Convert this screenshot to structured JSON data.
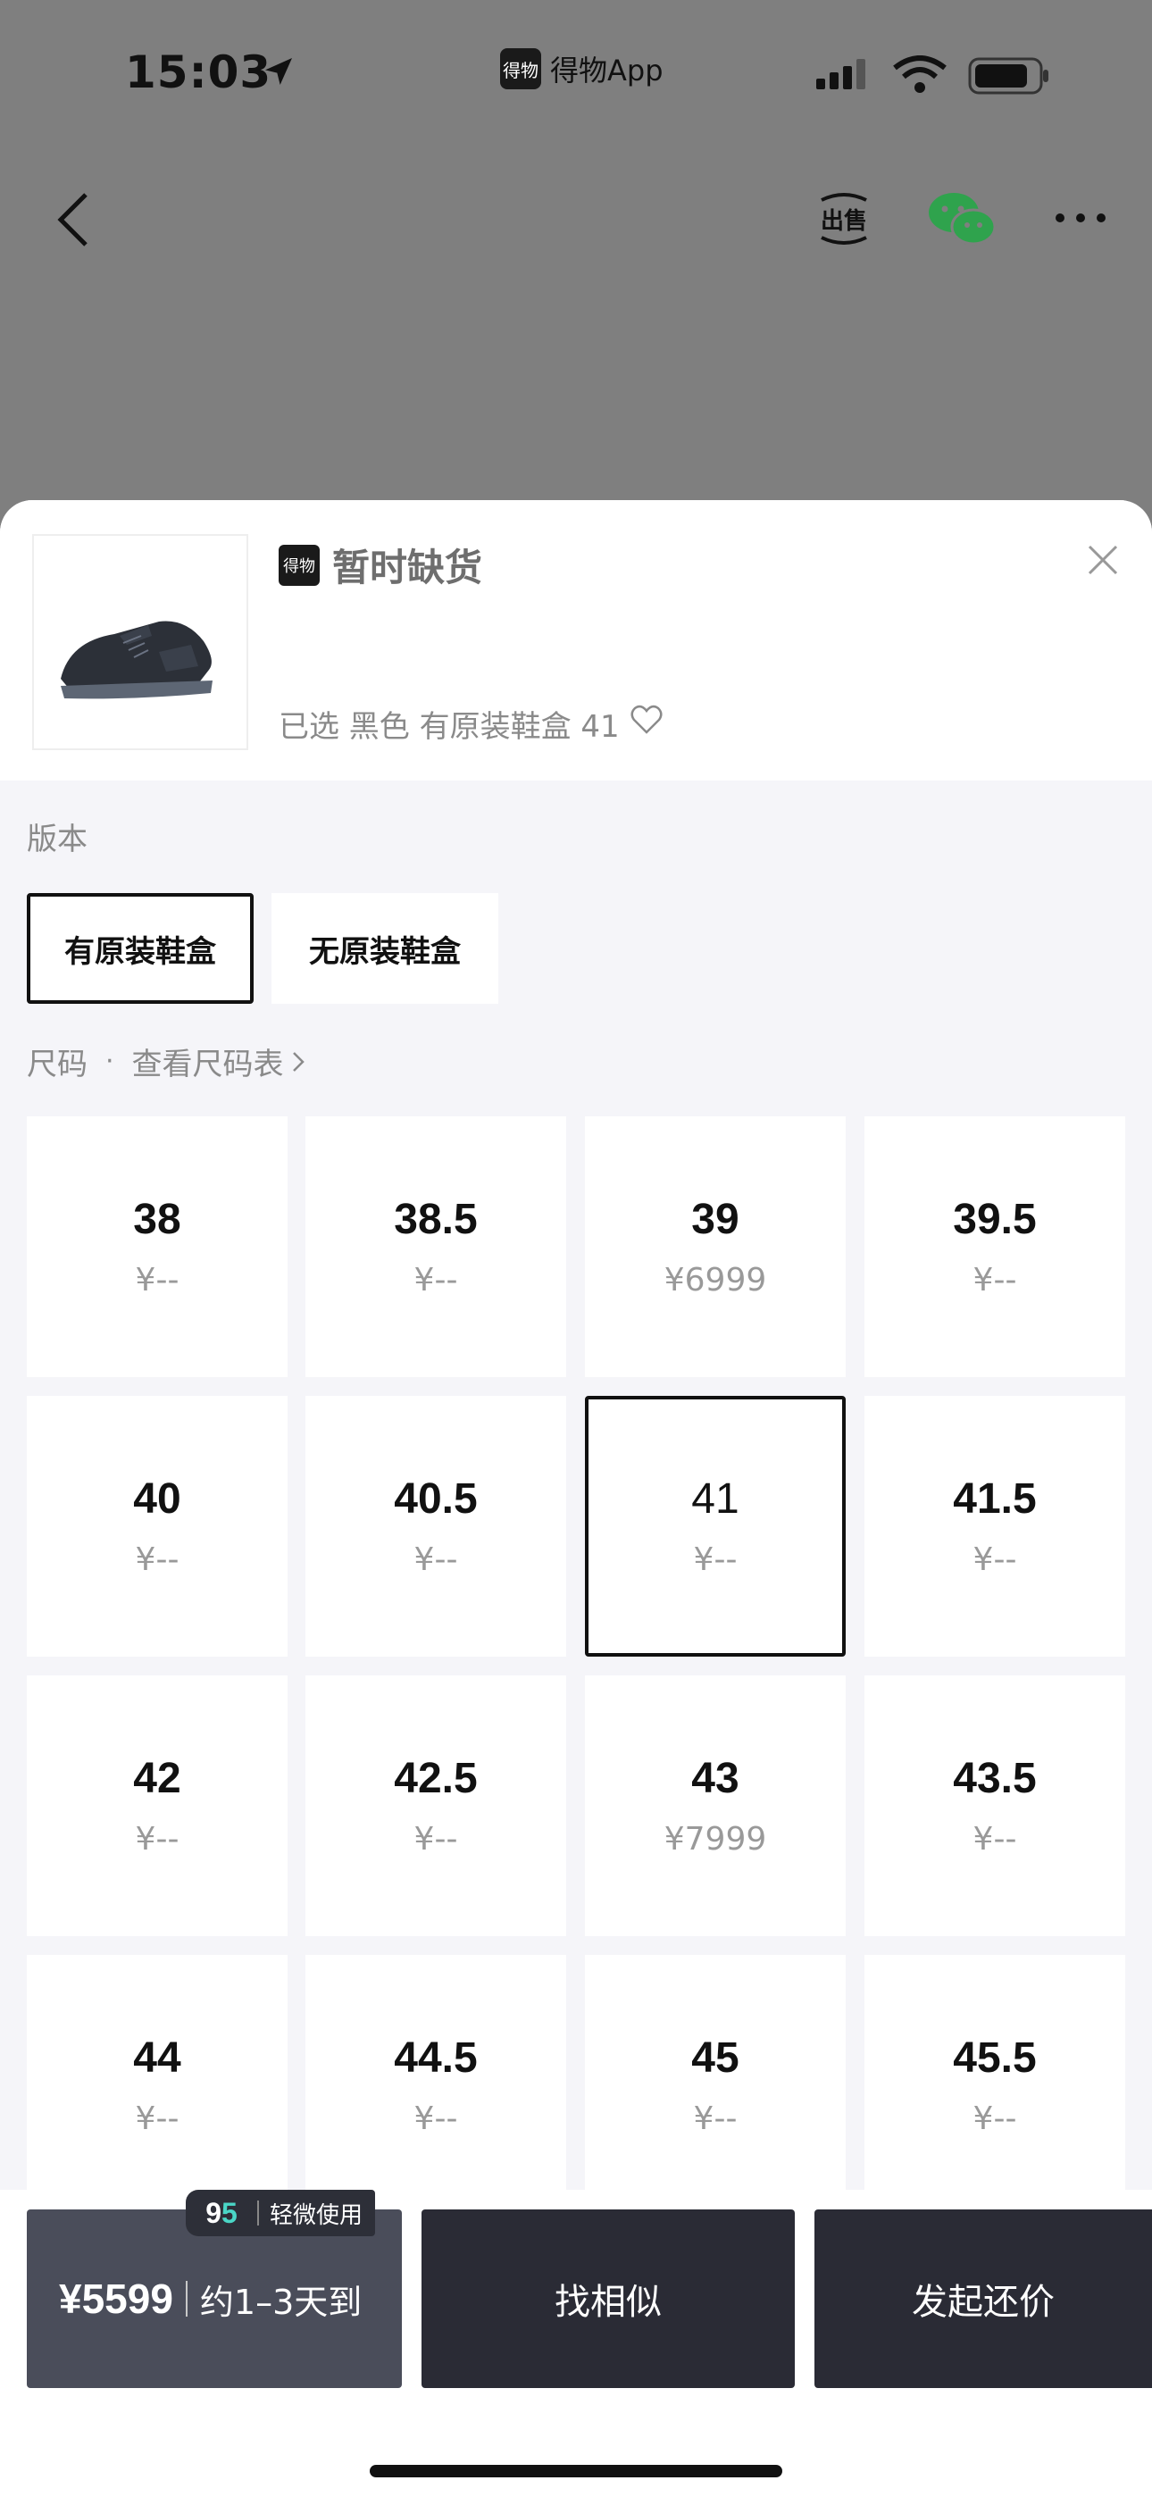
{
  "status": {
    "time": "15:03",
    "app_logo": "得物",
    "app_name": "得物App"
  },
  "nav": {
    "back_icon": "back-chevron-icon",
    "sell_icon": "sell-icon",
    "sell_label": "出售",
    "wechat_icon": "wechat-icon",
    "more_icon": "more-icon"
  },
  "sheet": {
    "stock_logo": "得物",
    "stock_status": "暂时缺货",
    "selected_summary": "已选 黑色 有原装鞋盒 41",
    "version_label": "版本",
    "versions": [
      {
        "label": "有原装鞋盒",
        "selected": true
      },
      {
        "label": "无原装鞋盒",
        "selected": false
      }
    ],
    "size_label": "尺码",
    "size_chart_link": "查看尺码表",
    "sizes": [
      {
        "size": "38",
        "price": "¥--"
      },
      {
        "size": "38.5",
        "price": "¥--"
      },
      {
        "size": "39",
        "price": "¥6999"
      },
      {
        "size": "39.5",
        "price": "¥--"
      },
      {
        "size": "40",
        "price": "¥--"
      },
      {
        "size": "40.5",
        "price": "¥--"
      },
      {
        "size": "41",
        "price": "¥--",
        "selected": true
      },
      {
        "size": "41.5",
        "price": "¥--"
      },
      {
        "size": "42",
        "price": "¥--"
      },
      {
        "size": "42.5",
        "price": "¥--"
      },
      {
        "size": "43",
        "price": "¥7999"
      },
      {
        "size": "43.5",
        "price": "¥--"
      },
      {
        "size": "44",
        "price": "¥--"
      },
      {
        "size": "44.5",
        "price": "¥--"
      },
      {
        "size": "45",
        "price": "¥--"
      },
      {
        "size": "45.5",
        "price": "¥--"
      }
    ]
  },
  "bottom": {
    "badge_score_main": "9",
    "badge_score_sub": "5",
    "badge_text": "轻微使用",
    "price": "¥5599",
    "eta": "约1–3天到",
    "find_similar": "找相似",
    "counter_offer": "发起还价"
  },
  "colors": {
    "overlay": "#7f7f7f",
    "dark_button": "#2a2b35",
    "price_button": "#4a4d5a",
    "badge_teal": "#4ad6c6"
  }
}
